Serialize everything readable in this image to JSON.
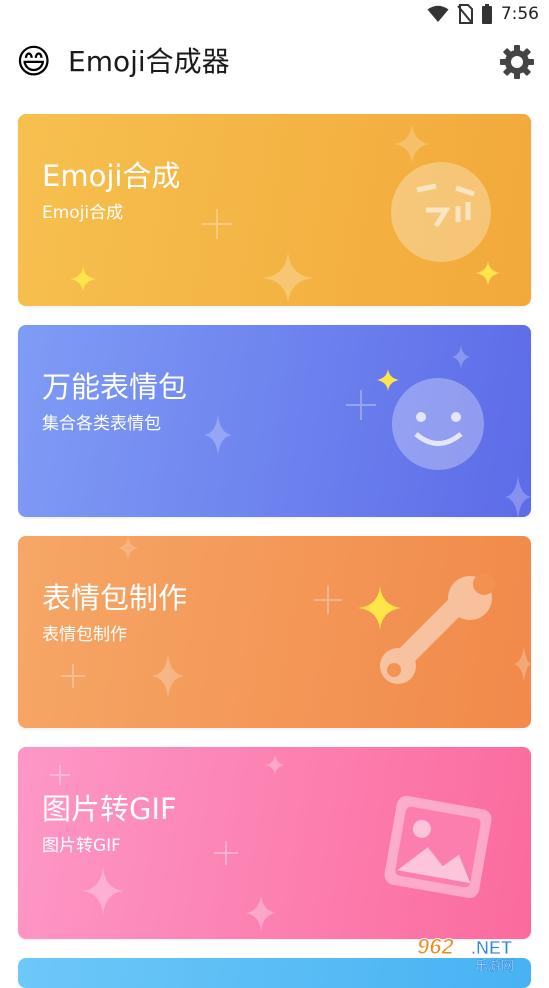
{
  "status_bar": {
    "time": "7:56"
  },
  "app_bar": {
    "emoji": "😄",
    "title": "Emoji合成器",
    "settings_icon": "gear-icon"
  },
  "cards": [
    {
      "title": "Emoji合成",
      "subtitle": "Emoji合成",
      "icon": "emoji-mix-face-icon",
      "color": "#f4b545"
    },
    {
      "title": "万能表情包",
      "subtitle": "集合各类表情包",
      "icon": "smiley-face-icon",
      "color": "#6f84ef"
    },
    {
      "title": "表情包制作",
      "subtitle": "表情包制作",
      "icon": "wrench-icon",
      "color": "#f39a56"
    },
    {
      "title": "图片转GIF",
      "subtitle": "图片转GIF",
      "icon": "image-icon",
      "color": "#fc80b0"
    }
  ],
  "watermark": {
    "number": "962",
    "suffix": ".NET",
    "text": "乐游网"
  }
}
